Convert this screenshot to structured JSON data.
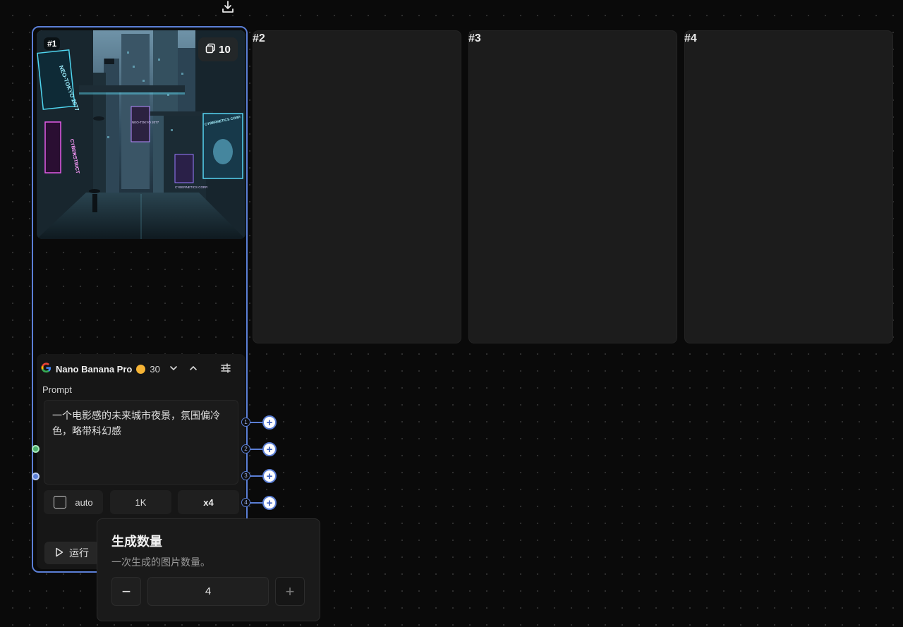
{
  "nodes": [
    {
      "label": "#1",
      "usage_count": "10"
    },
    {
      "label": "#2"
    },
    {
      "label": "#3"
    },
    {
      "label": "#4"
    }
  ],
  "image_text": {
    "neon_left": "NEO-TOKYO 2077",
    "neon_vertical": "CYBERSTRICT",
    "neon_center": "NEO-TOKYO 2077",
    "neon_right_top": "CYBERNETICS CORP.",
    "neon_right_bottom": "CYBERNETICS CORP."
  },
  "panel": {
    "model_name": "Nano Banana Pro",
    "credits": "30",
    "prompt_label": "Prompt",
    "prompt_text": "一个电影感的未来城市夜景，氛围偏冷色，略带科幻感",
    "options": {
      "auto_label": "auto",
      "resolution": "1K",
      "count": "x4"
    },
    "run_label": "运行"
  },
  "outputs": [
    "1",
    "2",
    "3",
    "4"
  ],
  "popover": {
    "title": "生成数量",
    "description": "一次生成的图片数量。",
    "value": "4",
    "minus": "−",
    "plus": "+"
  },
  "colors": {
    "accent": "#5b7fd6",
    "canvas": "#0a0a0a",
    "coin": "#f5b335",
    "input_port": "#4caf6e"
  },
  "icons": [
    "download-icon",
    "google-logo-icon",
    "coin-icon",
    "chevron-down-icon",
    "chevron-up-icon",
    "sliders-icon",
    "play-icon",
    "plus-icon",
    "minus-icon",
    "image-stack-icon"
  ]
}
